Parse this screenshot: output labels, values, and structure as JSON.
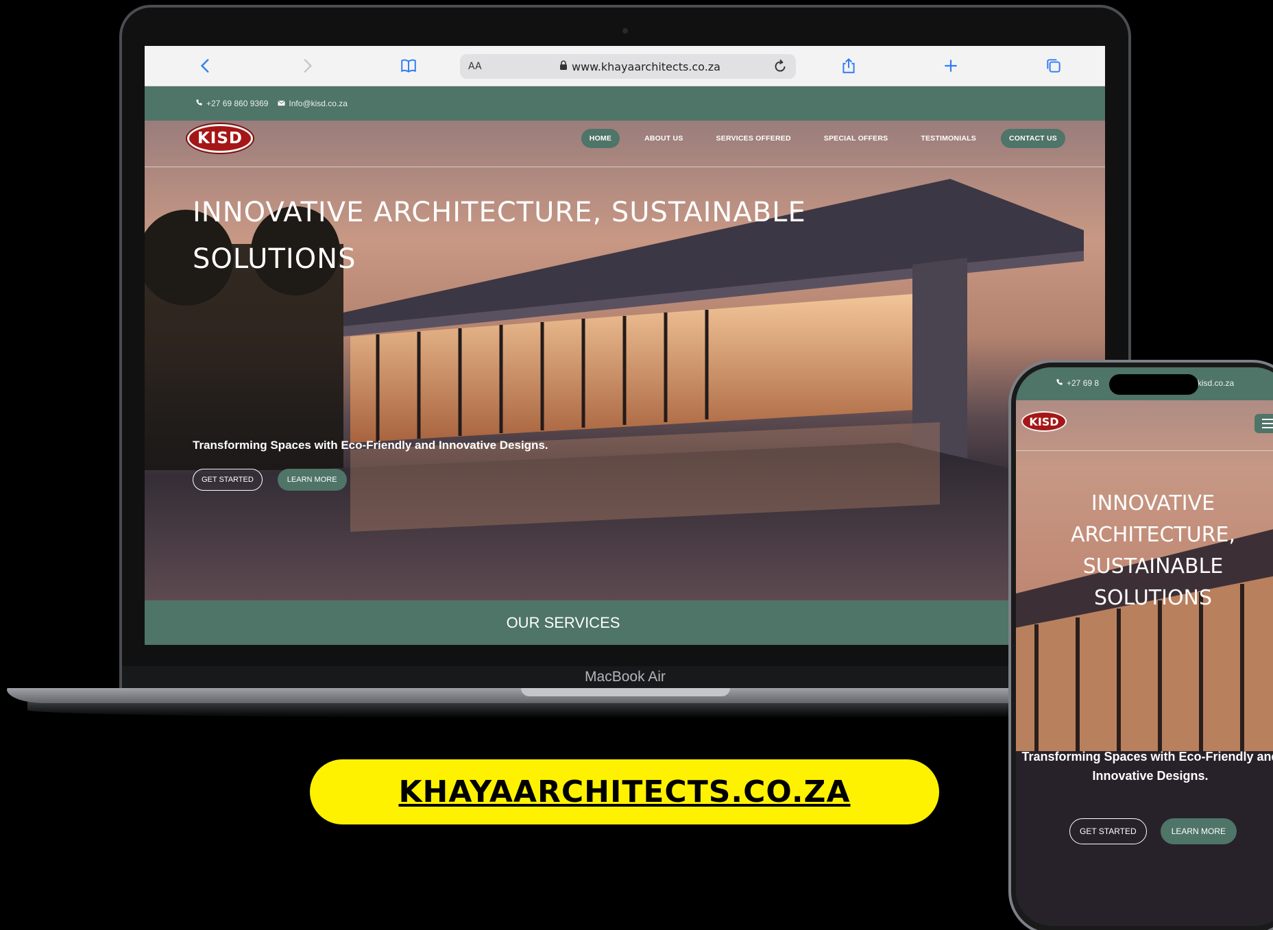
{
  "browser": {
    "text_size_label": "AA",
    "url": "www.khayaarchitects.co.za"
  },
  "site": {
    "phone": "+27 69 860 9369",
    "email": "Info@kisd.co.za",
    "logo_text": "KISD",
    "nav": [
      "HOME",
      "ABOUT US",
      "SERVICES OFFERED",
      "SPECIAL OFFERS",
      "TESTIMONIALS",
      "CONTACT US"
    ],
    "hero_title": "INNOVATIVE ARCHITECTURE, SUSTAINABLE SOLUTIONS",
    "hero_subtitle": "Transforming Spaces with Eco-Friendly and Innovative Designs.",
    "btn_get_started": "GET STARTED",
    "btn_learn_more": "LEARN MORE",
    "services_heading": "OUR SERVICES"
  },
  "device": {
    "laptop_label": "MacBook Air"
  },
  "phone_view": {
    "contact_left": "+27 69 8",
    "contact_right": "o@kisd.co.za",
    "logo_text": "KISD",
    "hero_title": "INNOVATIVE ARCHITECTURE, SUSTAINABLE SOLUTIONS",
    "hero_subtitle": "Transforming Spaces with Eco-Friendly and Innovative Designs.",
    "btn_get_started": "GET STARTED",
    "btn_learn_more": "LEARN MORE"
  },
  "banner": {
    "link_text": "KHAYAARCHITECTS.CO.ZA"
  },
  "colors": {
    "brand_green": "#4f7468",
    "logo_red": "#a51717",
    "banner_yellow": "#fff200"
  }
}
